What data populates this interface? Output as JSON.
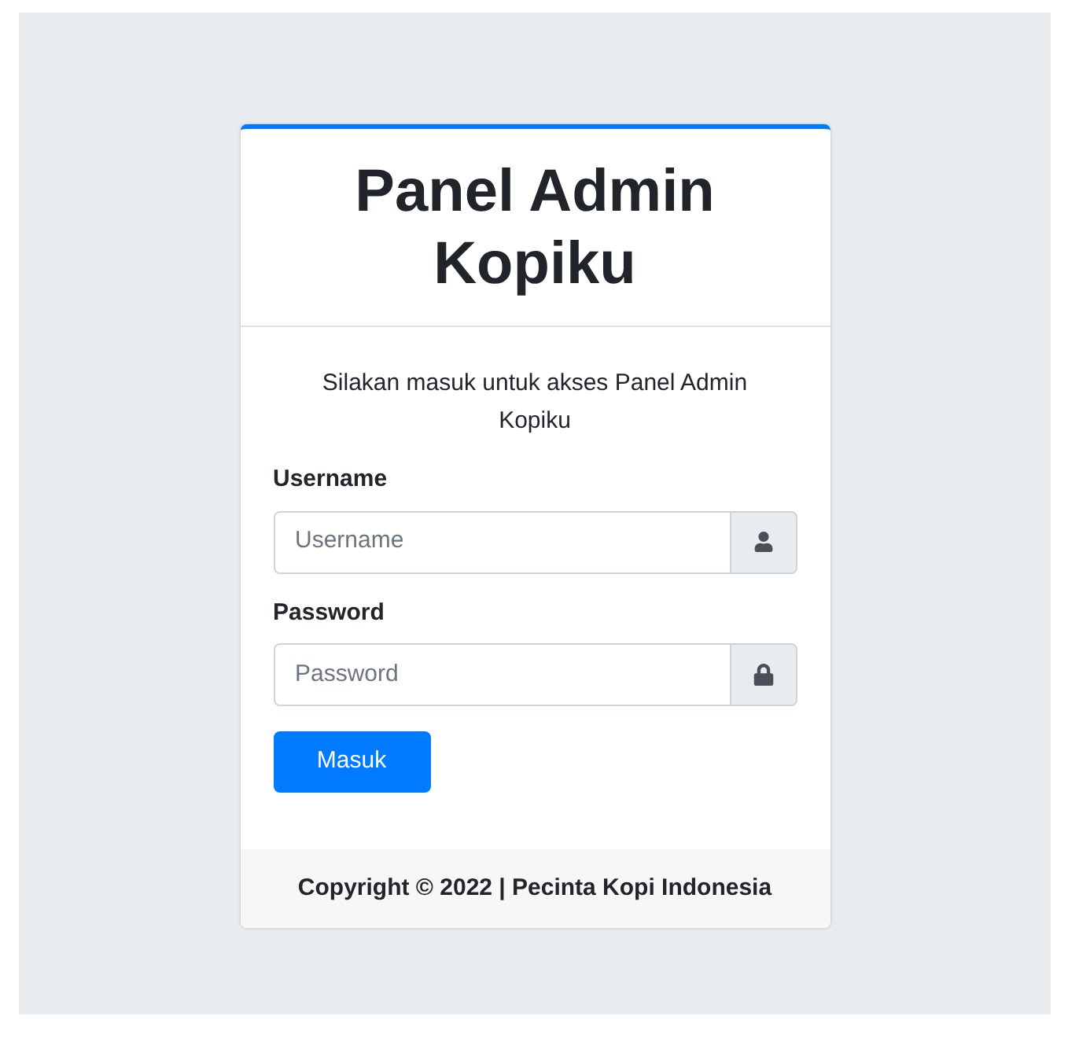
{
  "card": {
    "title": "Panel Admin Kopiku",
    "message": "Silakan masuk untuk akses Panel Admin Kopiku"
  },
  "fields": [
    {
      "kind": "user",
      "label": "Username",
      "placeholder": "Username"
    },
    {
      "kind": "lock",
      "label": "Password",
      "placeholder": "Password"
    }
  ],
  "submit": "Masuk",
  "footer": "Copyright © 2022 | Pecinta Kopi Indonesia"
}
